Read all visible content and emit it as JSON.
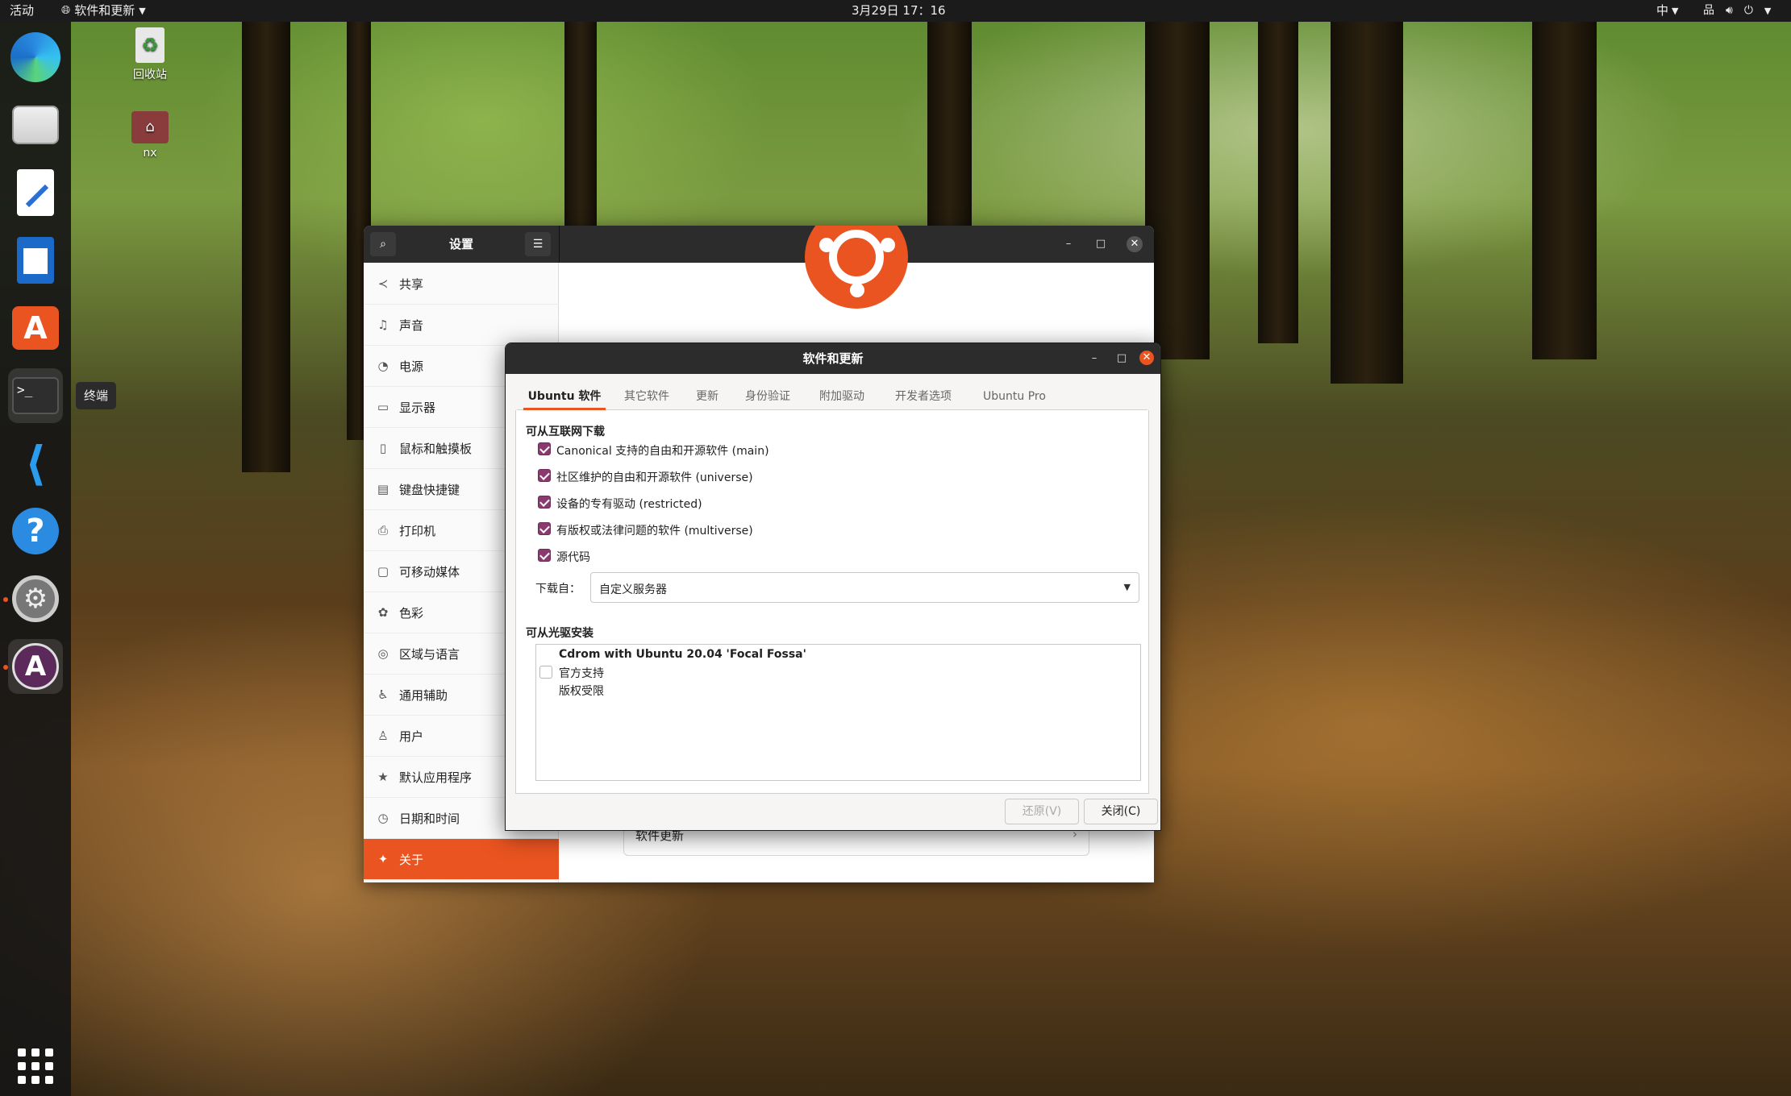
{
  "topbar": {
    "activities": "活动",
    "app_menu": "软件和更新",
    "clock": "3月29日 17：16",
    "input_method": "中"
  },
  "desktop": {
    "trash_label": "回收站",
    "home_label": "nx"
  },
  "dock": {
    "tooltip": "终端"
  },
  "settings": {
    "title": "设置",
    "panel_title": "关于",
    "sidebar": [
      {
        "label": "共享",
        "icon": "share-icon"
      },
      {
        "label": "声音",
        "icon": "music-note-icon"
      },
      {
        "label": "电源",
        "icon": "power-icon"
      },
      {
        "label": "显示器",
        "icon": "display-icon"
      },
      {
        "label": "鼠标和触摸板",
        "icon": "mouse-icon"
      },
      {
        "label": "键盘快捷键",
        "icon": "keyboard-icon"
      },
      {
        "label": "打印机",
        "icon": "printer-icon"
      },
      {
        "label": "可移动媒体",
        "icon": "usb-icon"
      },
      {
        "label": "色彩",
        "icon": "palette-icon"
      },
      {
        "label": "区域与语言",
        "icon": "globe-icon"
      },
      {
        "label": "通用辅助",
        "icon": "accessibility-icon"
      },
      {
        "label": "用户",
        "icon": "user-icon"
      },
      {
        "label": "默认应用程序",
        "icon": "star-icon"
      },
      {
        "label": "日期和时间",
        "icon": "clock-icon"
      },
      {
        "label": "关于",
        "icon": "sparkle-icon"
      }
    ],
    "software_update_row": "软件更新",
    "accent_color": "#e95420"
  },
  "dialog": {
    "title": "软件和更新",
    "tabs": [
      "Ubuntu 软件",
      "其它软件",
      "更新",
      "身份验证",
      "附加驱动",
      "开发者选项",
      "Ubuntu Pro"
    ],
    "internet_section": "可从互联网下载",
    "sources": [
      {
        "label": "Canonical 支持的自由和开源软件 (main)",
        "checked": true
      },
      {
        "label": "社区维护的自由和开源软件 (universe)",
        "checked": true
      },
      {
        "label": "设备的专有驱动 (restricted)",
        "checked": true
      },
      {
        "label": "有版权或法律问题的软件 (multiverse)",
        "checked": true
      },
      {
        "label": "源代码",
        "checked": true
      }
    ],
    "download_from_label": "下载自：",
    "download_from_value": "自定义服务器",
    "cdrom_section": "可从光驱安装",
    "cdrom": {
      "name": "Cdrom with Ubuntu 20.04 'Focal Fossa'",
      "line2": "官方支持",
      "line3": "版权受限",
      "checked": false
    },
    "revert_button": "还原(V)",
    "close_button": "关闭(C)",
    "checkbox_color": "#8b3a70"
  }
}
